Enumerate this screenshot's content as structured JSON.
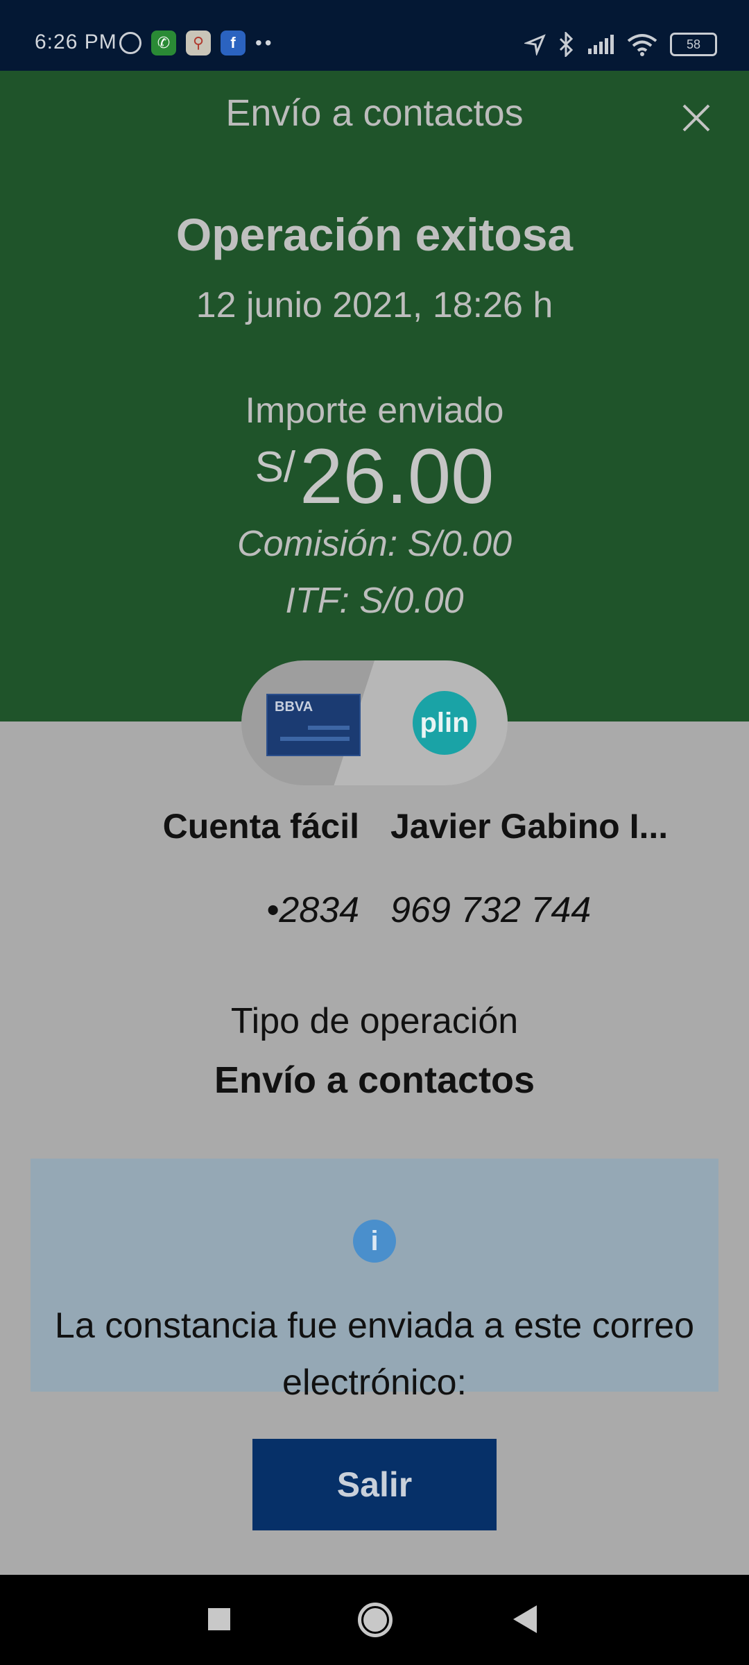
{
  "status_bar": {
    "time": "6:26 PM",
    "battery": "58",
    "left_icons": [
      "alarm-icon",
      "whatsapp-icon",
      "maps-icon",
      "facebook-icon"
    ],
    "more": "••"
  },
  "header": {
    "title": "Envío a contactos"
  },
  "receipt": {
    "status": "Operación exitosa",
    "date": "12 junio 2021, 18:26 h",
    "amount_label": "Importe enviado",
    "currency": "S/",
    "amount": "26.00",
    "commission": "Comisión:  S/0.00",
    "itf": "ITF:  S/0.00"
  },
  "origin": {
    "logo_text": "BBVA",
    "account_name": "Cuenta fácil",
    "account_number": "•2834"
  },
  "destination": {
    "logo_text": "plin",
    "contact_name": "Javier Gabino I...",
    "phone": "969 732 744"
  },
  "operation": {
    "type_label": "Tipo de operación",
    "type_value": "Envío a contactos"
  },
  "info": {
    "message": "La constancia fue enviada a este correo electrónico:"
  },
  "actions": {
    "exit_label": "Salir"
  },
  "colors": {
    "header_green": "#1f542a",
    "button_navy": "#063068",
    "status_bar": "#041834",
    "info_box": "#95a8b5"
  }
}
